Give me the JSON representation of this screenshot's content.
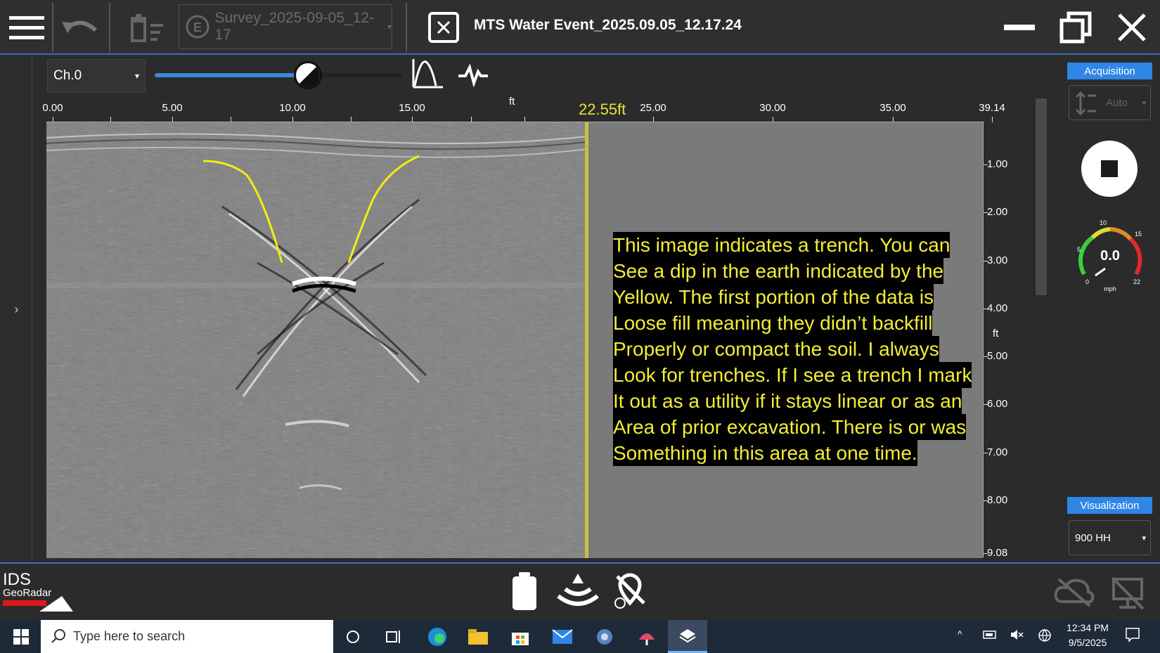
{
  "window": {
    "title": "MTS Water Event_2025.09.05_12.17.24",
    "survey_select": "Survey_2025-09-05_12-17"
  },
  "toolbar": {
    "channel": "Ch.0",
    "gain_level": 0.62
  },
  "axes": {
    "x_unit": "ft",
    "x_ticks": [
      "0.00",
      "5.00",
      "10.00",
      "15.00",
      "25.00",
      "30.00",
      "35.00",
      "39.14"
    ],
    "y_unit": "ft",
    "y_ticks": [
      "1.00",
      "2.00",
      "3.00",
      "4.00",
      "5.00",
      "6.00",
      "7.00",
      "8.00",
      "9.08"
    ]
  },
  "cursor": {
    "position_label": "22.55ft",
    "position_ft": 22.55
  },
  "annotation": {
    "lines": [
      "This image indicates a trench. You can",
      "See a dip in the earth indicated by the",
      "Yellow. The first portion of the data is",
      "Loose fill meaning they didn’t backfill",
      "Properly or compact the soil. I always",
      "Look for trenches. If I see a trench I mark",
      "It out as a utility if it stays linear or as an",
      "Area of prior excavation. There is or was",
      "Something in this area at one time."
    ]
  },
  "right_panel": {
    "acquisition_label": "Acquisition",
    "auto_label": "Auto",
    "speed_value": "0.0",
    "speed_unit": "mph",
    "gauge_ticks": [
      "0",
      "5",
      "10",
      "15",
      "22"
    ],
    "visualization_label": "Visualization",
    "visualization_value": "900 HH"
  },
  "branding": {
    "logo_top": "IDS",
    "logo_bottom": "GeoRadar"
  },
  "taskbar": {
    "search_placeholder": "Type here to search",
    "time": "12:34 PM",
    "date": "9/5/2025"
  },
  "colors": {
    "accent": "#2e86e6",
    "annotation_text": "#f2ee35",
    "cursor": "#c8c33a"
  }
}
